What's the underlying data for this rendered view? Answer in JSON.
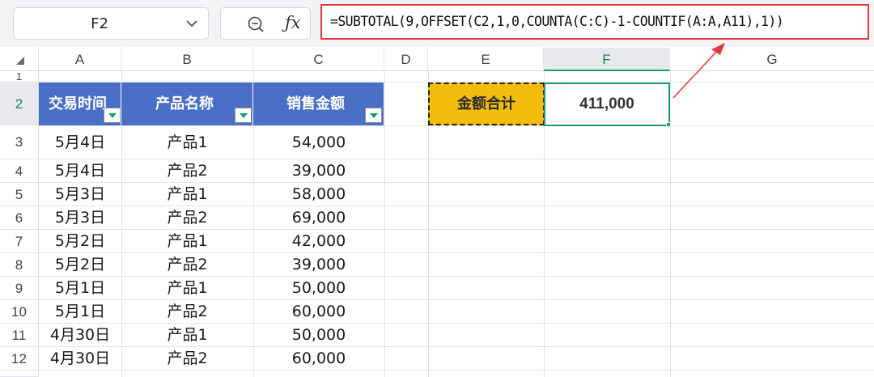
{
  "name_box": {
    "value": "F2"
  },
  "formula_bar": {
    "formula": "=SUBTOTAL(9,OFFSET(C2,1,0,COUNTA(C:C)-1-COUNTIF(A:A,A11),1))"
  },
  "columns": [
    "A",
    "B",
    "C",
    "D",
    "E",
    "F",
    "G"
  ],
  "rows": [
    "1",
    "2",
    "3",
    "4",
    "5",
    "6",
    "7",
    "8",
    "9",
    "10",
    "11",
    "12"
  ],
  "table": {
    "headers": [
      "交易时间",
      "产品名称",
      "销售金额"
    ],
    "rows": [
      [
        "5月4日",
        "产品1",
        "54,000"
      ],
      [
        "5月4日",
        "产品2",
        "39,000"
      ],
      [
        "5月3日",
        "产品1",
        "58,000"
      ],
      [
        "5月3日",
        "产品2",
        "69,000"
      ],
      [
        "5月2日",
        "产品1",
        "42,000"
      ],
      [
        "5月2日",
        "产品2",
        "39,000"
      ],
      [
        "5月1日",
        "产品1",
        "50,000"
      ],
      [
        "5月1日",
        "产品2",
        "60,000"
      ],
      [
        "4月30日",
        "产品1",
        "50,000"
      ],
      [
        "4月30日",
        "产品2",
        "60,000"
      ]
    ]
  },
  "summary": {
    "label": "金额合计",
    "value": "411,000"
  },
  "colors": {
    "header_fill": "#4a6fc6",
    "summary_fill": "#f2bd0a",
    "selection": "#1e9e6a",
    "formula_highlight": "#e23a3a"
  },
  "icons": {
    "name_box_dropdown": "chevron-down-icon",
    "zoom": "zoom-out-icon",
    "function": "fx-icon",
    "filter": "filter-dropdown-icon",
    "select_all": "select-all-triangle-icon"
  }
}
